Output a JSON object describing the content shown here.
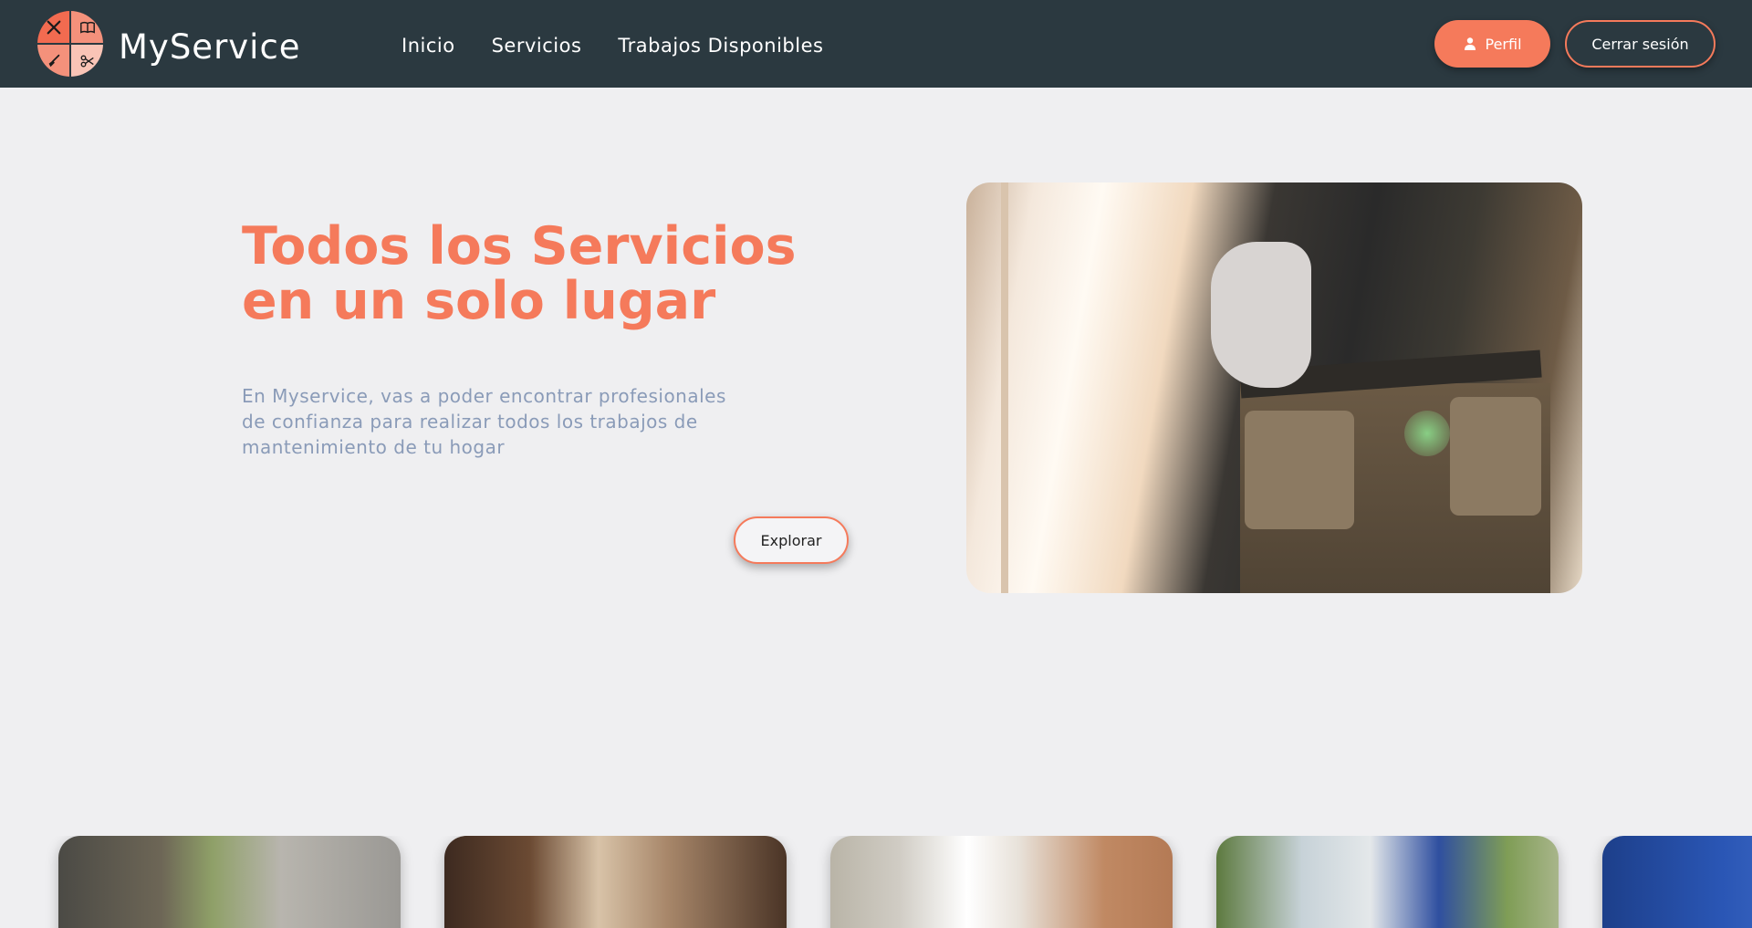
{
  "brand": {
    "name": "MyService"
  },
  "nav": {
    "links": [
      "Inicio",
      "Servicios",
      "Trabajos Disponibles"
    ],
    "profile_label": "Perfil",
    "logout_label": "Cerrar sesión"
  },
  "hero": {
    "title": "Todos los Servicios en un solo lugar",
    "description": "En Myservice, vas a poder encontrar profesionales de confianza para realizar todos los trabajos de mantenimiento de tu hogar",
    "cta_label": "Explorar"
  },
  "colors": {
    "accent": "#f57a5b",
    "header_bg": "#2b3940",
    "page_bg": "#efeff1",
    "description_text": "#8a9bb8"
  },
  "icons": {
    "logo_quadrants": [
      "tools-icon",
      "book-icon",
      "broom-icon",
      "scissors-icon"
    ],
    "profile": "user-icon"
  }
}
